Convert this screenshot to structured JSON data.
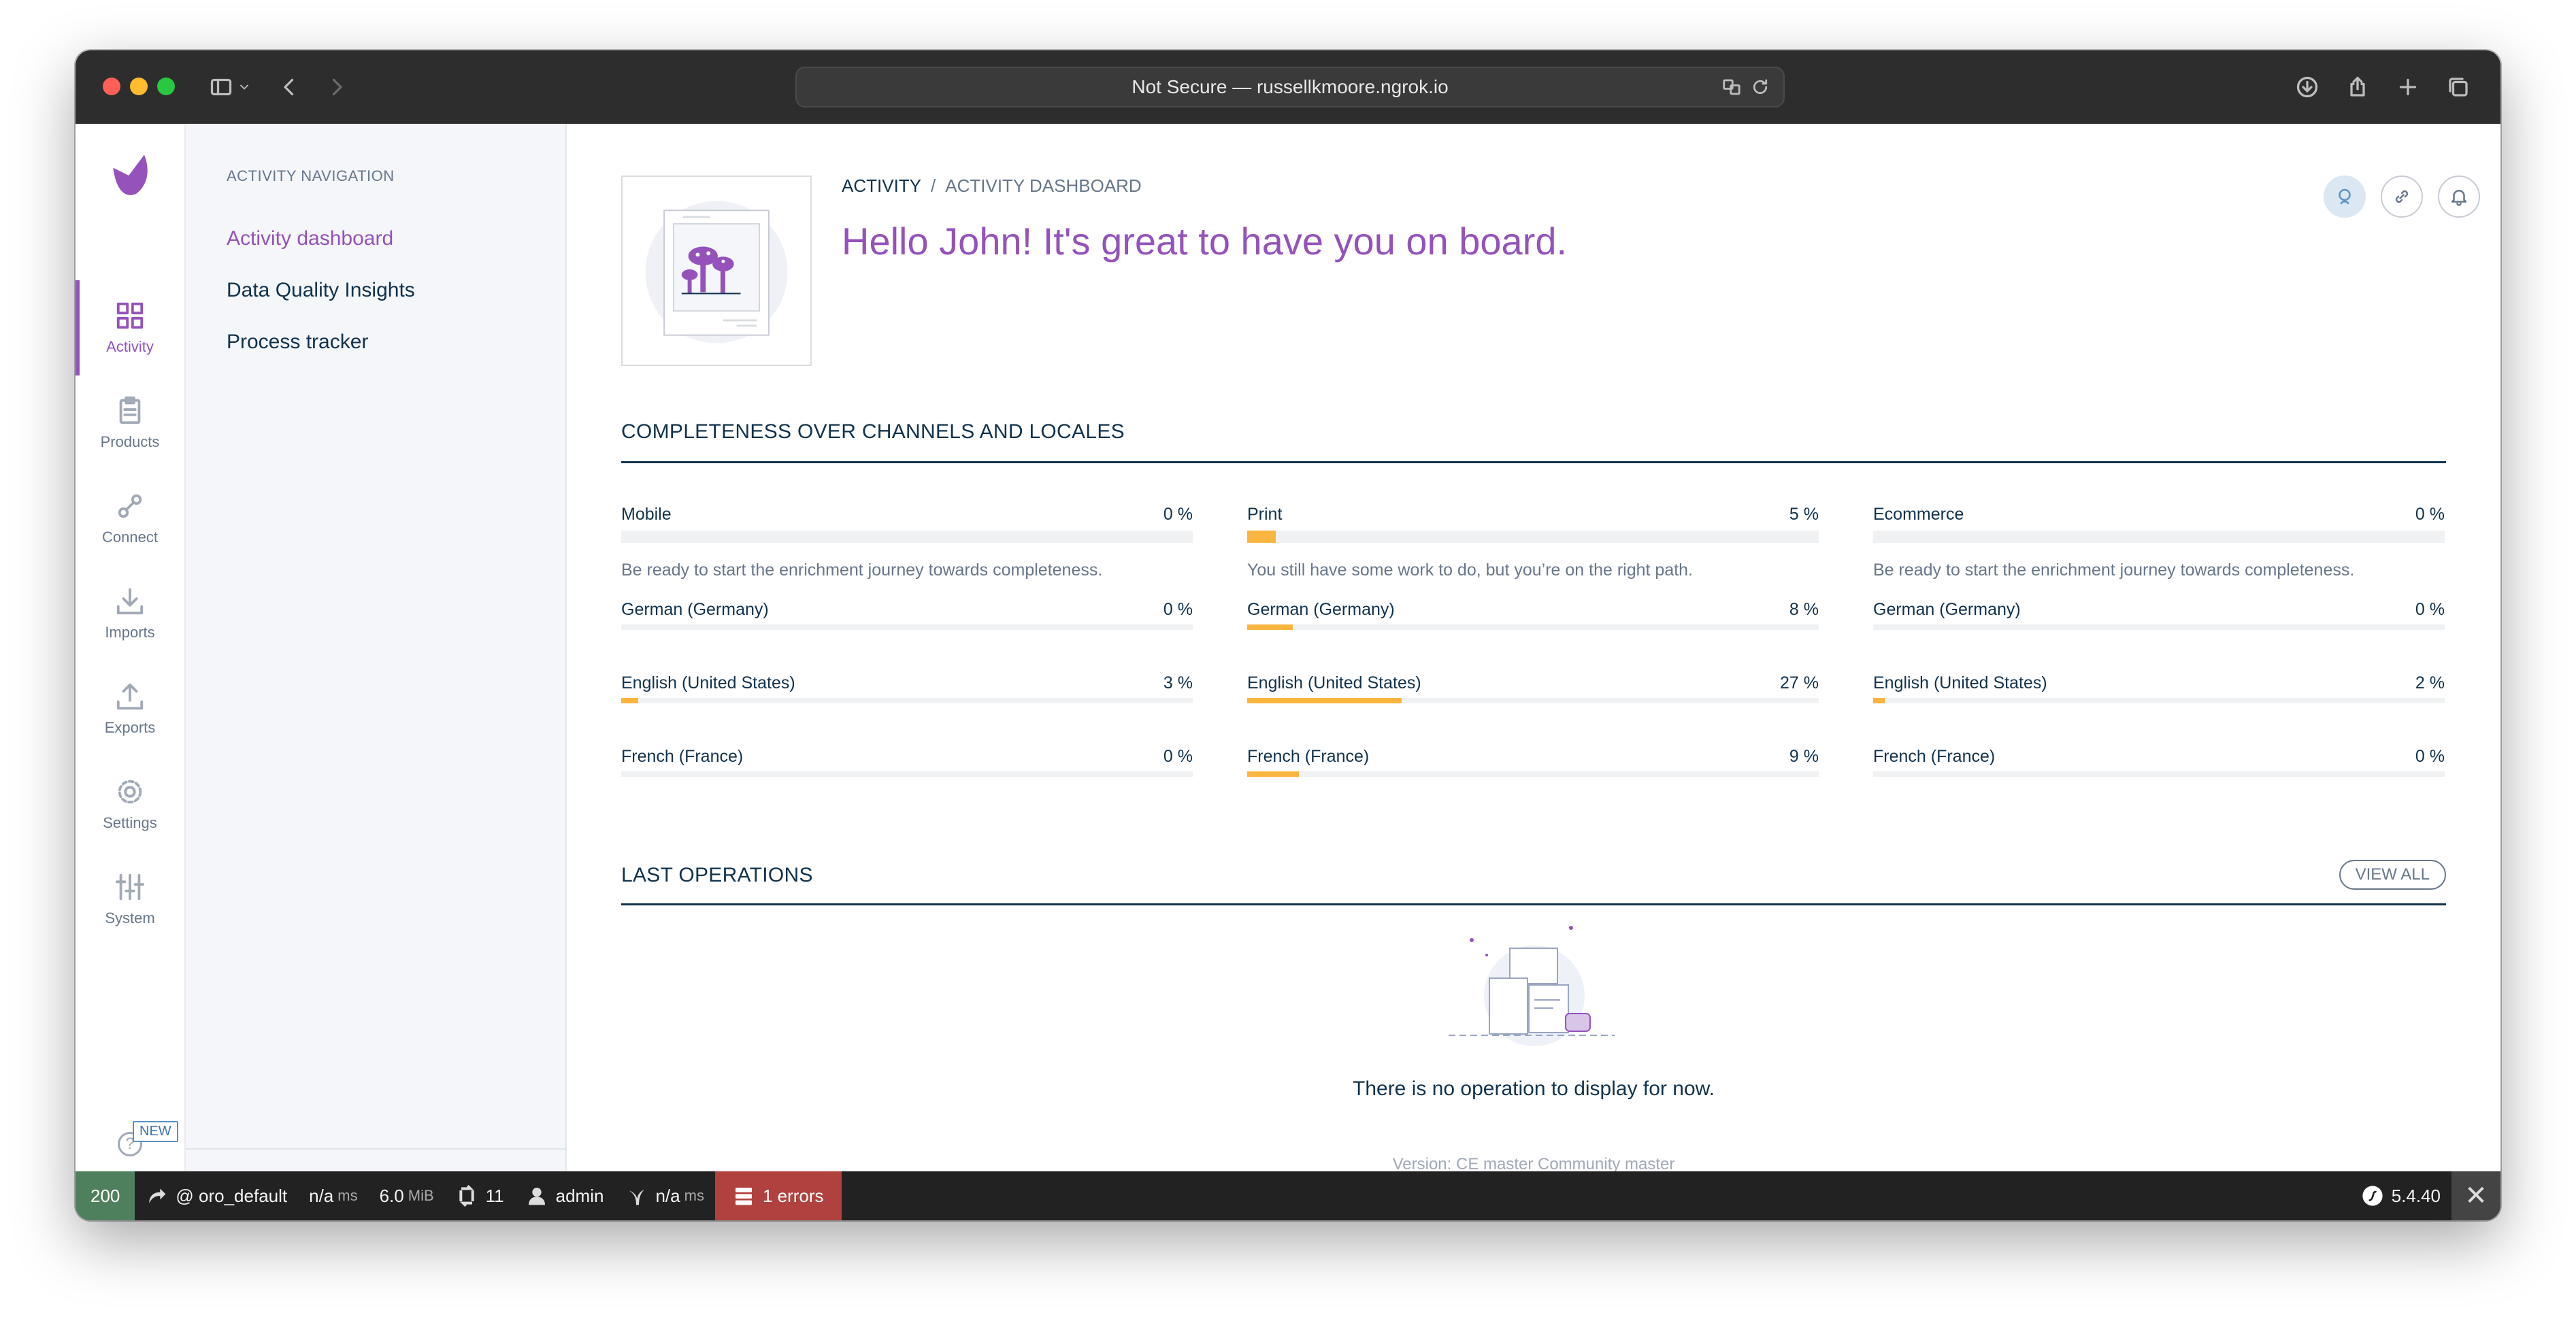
{
  "browser": {
    "url_text": "Not Secure — russellkmoore.ngrok.io"
  },
  "main_nav": {
    "items": [
      {
        "label": "Activity",
        "icon": "grid-icon"
      },
      {
        "label": "Products",
        "icon": "clipboard-icon"
      },
      {
        "label": "Connect",
        "icon": "link-icon"
      },
      {
        "label": "Imports",
        "icon": "import-icon"
      },
      {
        "label": "Exports",
        "icon": "export-icon"
      },
      {
        "label": "Settings",
        "icon": "gear-icon"
      },
      {
        "label": "System",
        "icon": "sliders-icon"
      }
    ],
    "new_badge": "NEW"
  },
  "column_nav": {
    "title": "ACTIVITY NAVIGATION",
    "items": [
      "Activity dashboard",
      "Data Quality Insights",
      "Process tracker"
    ]
  },
  "header": {
    "breadcrumb_1": "ACTIVITY",
    "breadcrumb_sep": "/",
    "breadcrumb_2": "ACTIVITY DASHBOARD",
    "greeting": "Hello John! It's great to have you on board."
  },
  "completeness": {
    "title": "COMPLETENESS OVER CHANNELS AND LOCALES",
    "channels": [
      {
        "name": "Mobile",
        "pct": "0 %",
        "value": 0,
        "message": "Be ready to start the enrichment journey towards completeness.",
        "locales": [
          {
            "name": "German (Germany)",
            "pct": "0 %",
            "value": 0
          },
          {
            "name": "English (United States)",
            "pct": "3 %",
            "value": 3
          },
          {
            "name": "French (France)",
            "pct": "0 %",
            "value": 0
          }
        ]
      },
      {
        "name": "Print",
        "pct": "5 %",
        "value": 5,
        "message": "You still have some work to do, but you’re on the right path.",
        "locales": [
          {
            "name": "German (Germany)",
            "pct": "8 %",
            "value": 8
          },
          {
            "name": "English (United States)",
            "pct": "27 %",
            "value": 27
          },
          {
            "name": "French (France)",
            "pct": "9 %",
            "value": 9
          }
        ]
      },
      {
        "name": "Ecommerce",
        "pct": "0 %",
        "value": 0,
        "message": "Be ready to start the enrichment journey towards completeness.",
        "locales": [
          {
            "name": "German (Germany)",
            "pct": "0 %",
            "value": 0
          },
          {
            "name": "English (United States)",
            "pct": "2 %",
            "value": 2
          },
          {
            "name": "French (France)",
            "pct": "0 %",
            "value": 0
          }
        ]
      }
    ]
  },
  "operations": {
    "title": "LAST OPERATIONS",
    "view_all": "VIEW ALL",
    "empty": "There is no operation to display for now.",
    "version": "Version: CE master Community master"
  },
  "debug_toolbar": {
    "status": "200",
    "route": "@ oro_default",
    "time": "n/a",
    "time_unit": "ms",
    "memory": "6.0",
    "memory_unit": "MiB",
    "queries": "11",
    "user": "admin",
    "twig": "n/a",
    "twig_unit": "ms",
    "errors": "1 errors",
    "version": "5.4.40",
    "close": "✕"
  },
  "colors": {
    "accent": "#9452ba",
    "bar_fill": "#f9b53f",
    "text": "#11324d",
    "muted": "#67768a"
  }
}
